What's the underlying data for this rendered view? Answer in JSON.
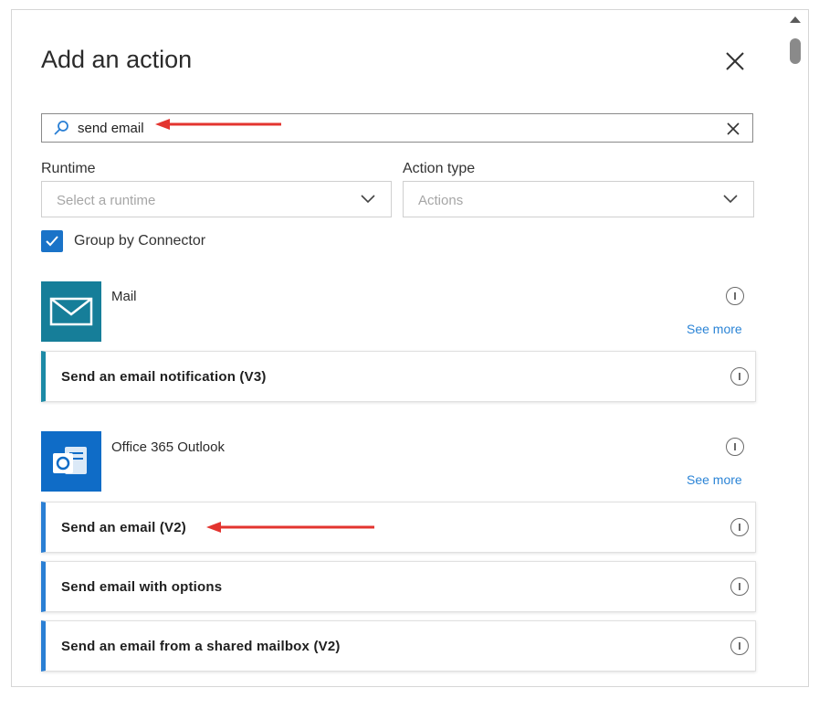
{
  "panel": {
    "title": "Add an action"
  },
  "search": {
    "value": "send email"
  },
  "runtime": {
    "label": "Runtime",
    "placeholder": "Select a runtime"
  },
  "action_type": {
    "label": "Action type",
    "selected": "Actions"
  },
  "group_by": {
    "label": "Group by Connector",
    "checked": true
  },
  "connectors": [
    {
      "name": "Mail",
      "icon": "envelope-icon",
      "color": "#167e99",
      "see_more": "See more",
      "actions": [
        {
          "label": "Send an email notification (V3)"
        }
      ]
    },
    {
      "name": "Office 365 Outlook",
      "icon": "outlook-icon",
      "color": "#0f6cc7",
      "see_more": "See more",
      "actions": [
        {
          "label": "Send an email (V2)"
        },
        {
          "label": "Send email with options"
        },
        {
          "label": "Send an email from a shared mailbox (V2)"
        }
      ]
    }
  ],
  "colors": {
    "accent": "#2a7fd4",
    "annotation_arrow": "#e3342f"
  }
}
